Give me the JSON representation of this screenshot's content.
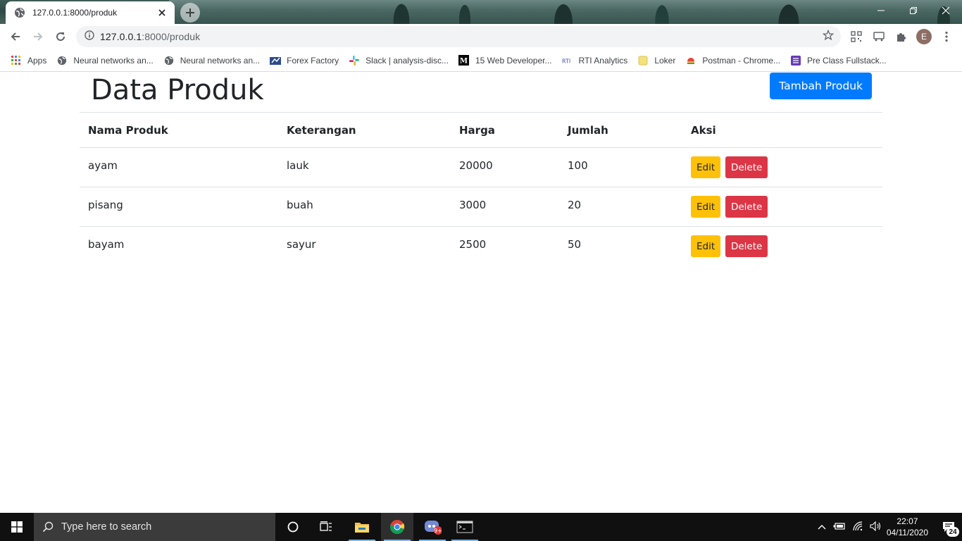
{
  "browser": {
    "tab_title": "127.0.0.1:8000/produk",
    "url_host": "127.0.0.1",
    "url_rest": ":8000/produk"
  },
  "bookmarks": [
    {
      "label": "Apps",
      "icon": "apps-grid-icon"
    },
    {
      "label": "Neural networks an...",
      "icon": "globe-icon"
    },
    {
      "label": "Neural networks an...",
      "icon": "globe-icon"
    },
    {
      "label": "Forex Factory",
      "icon": "forex-factory-icon"
    },
    {
      "label": "Slack | analysis-disc...",
      "icon": "slack-icon"
    },
    {
      "label": "15 Web Developer...",
      "icon": "medium-icon"
    },
    {
      "label": "RTI Analytics",
      "icon": "rti-icon"
    },
    {
      "label": "Loker",
      "icon": "folder-icon"
    },
    {
      "label": "Postman - Chrome...",
      "icon": "postman-icon"
    },
    {
      "label": "Pre Class Fullstack...",
      "icon": "form-icon"
    }
  ],
  "page": {
    "title": "Data Produk",
    "add_button": "Tambah Produk",
    "columns": [
      "Nama Produk",
      "Keterangan",
      "Harga",
      "Jumlah",
      "Aksi"
    ],
    "rows": [
      {
        "nama": "ayam",
        "keterangan": "lauk",
        "harga": "20000",
        "jumlah": "100"
      },
      {
        "nama": "pisang",
        "keterangan": "buah",
        "harga": "3000",
        "jumlah": "20"
      },
      {
        "nama": "bayam",
        "keterangan": "sayur",
        "harga": "2500",
        "jumlah": "50"
      }
    ],
    "edit_label": "Edit",
    "delete_label": "Delete"
  },
  "taskbar": {
    "search_placeholder": "Type here to search",
    "time": "22:07",
    "date": "04/11/2020",
    "notification_count": "24",
    "app_badge": "9+"
  },
  "colors": {
    "primary": "#007bff",
    "warning": "#ffc107",
    "danger": "#dc3545"
  }
}
